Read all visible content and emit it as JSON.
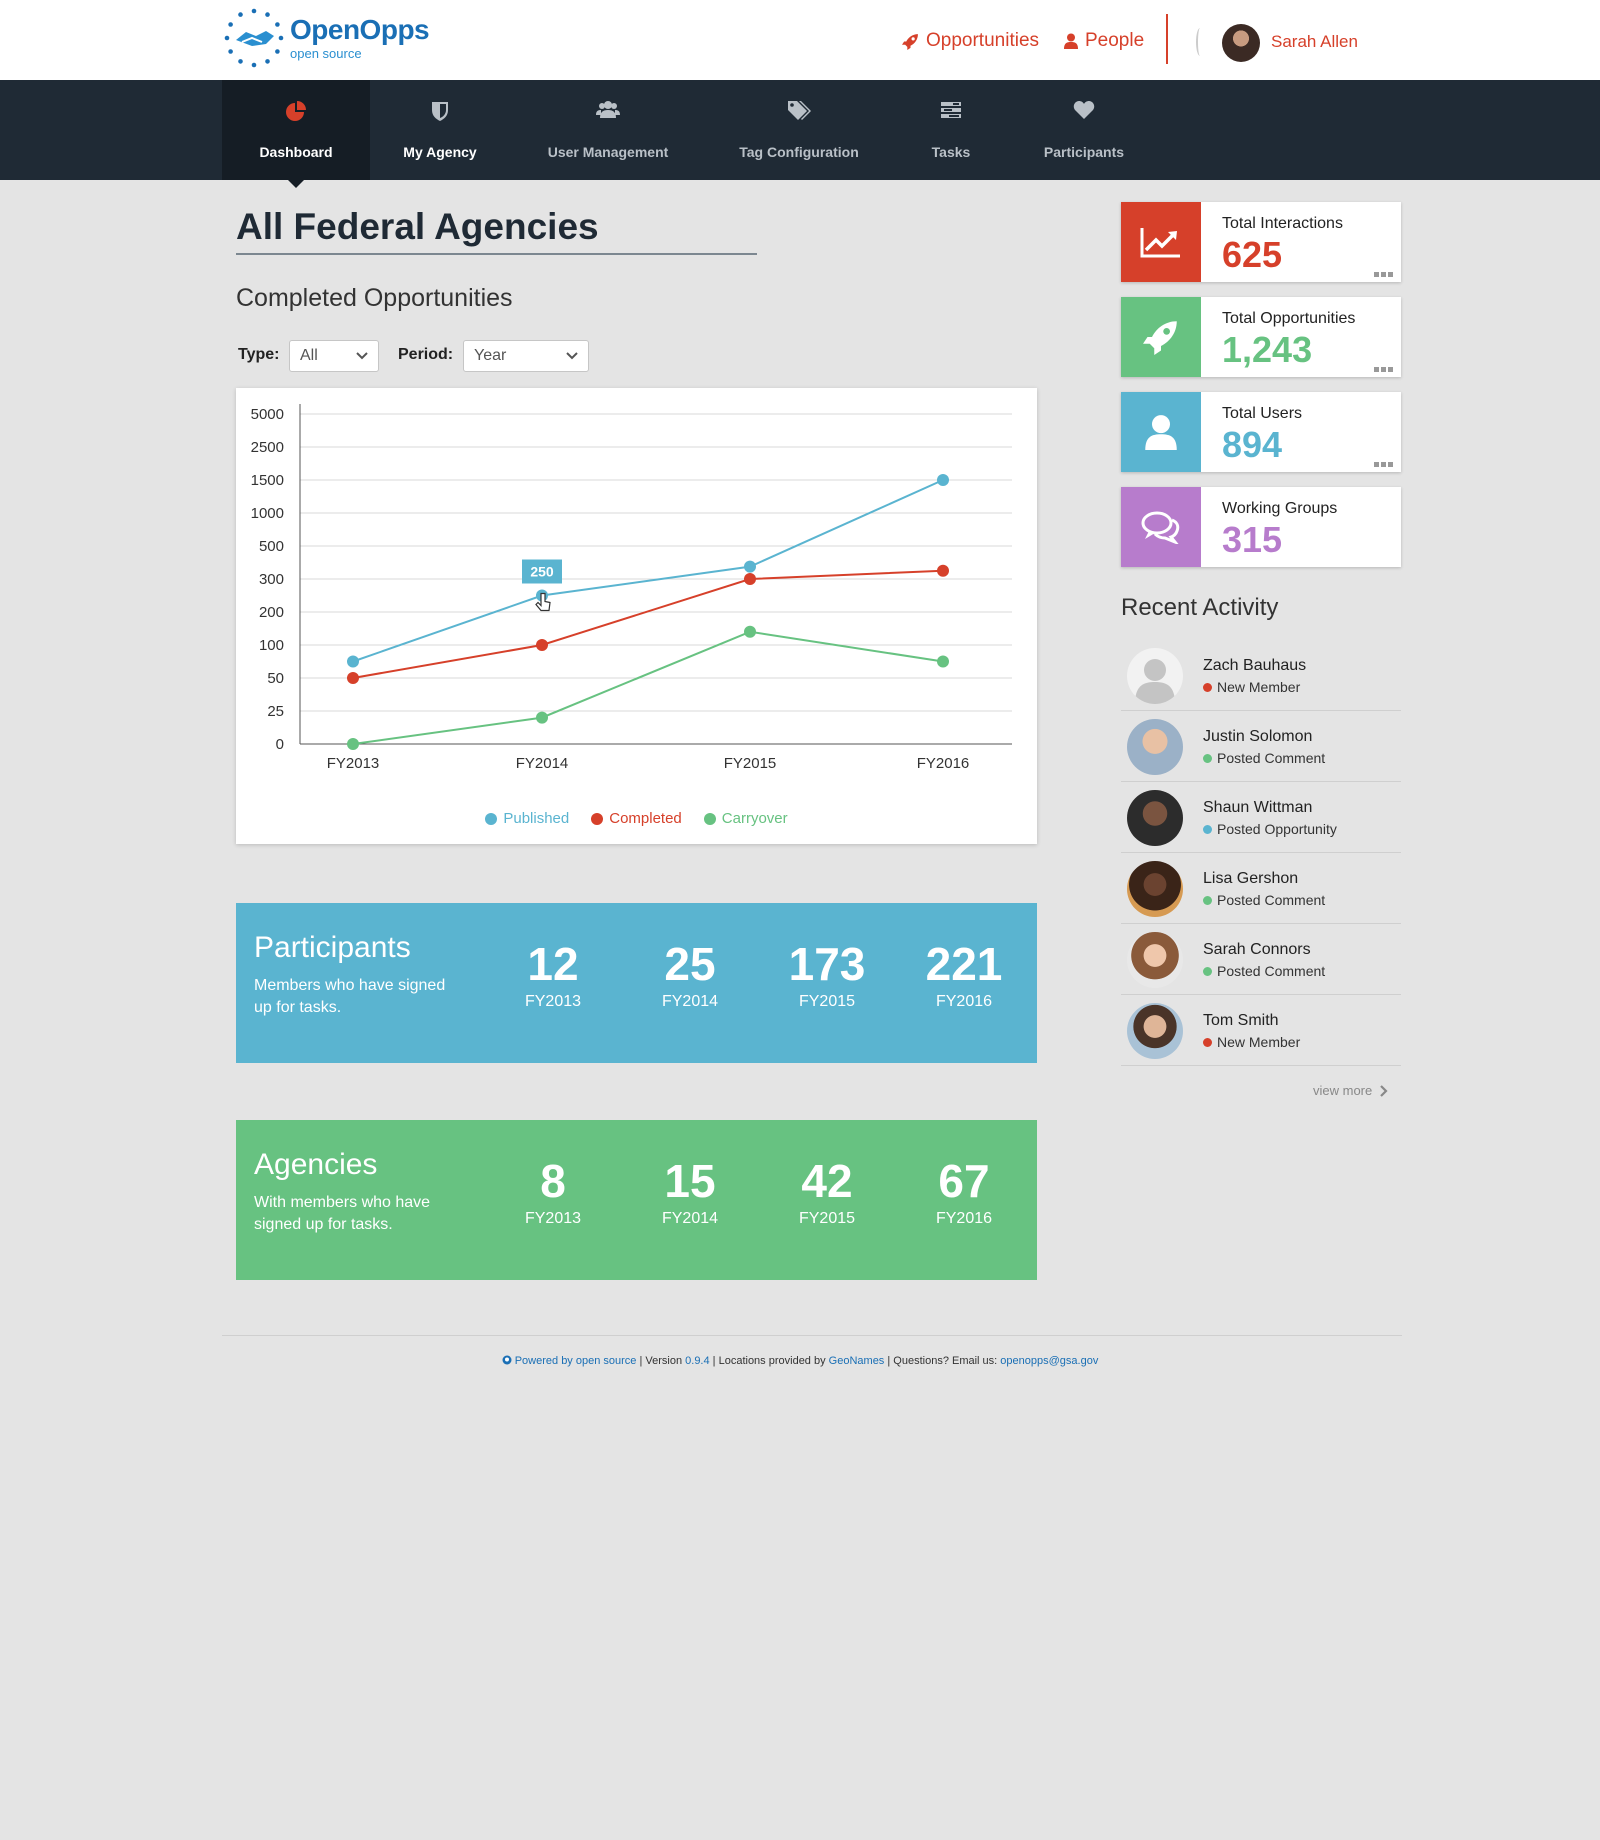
{
  "header": {
    "brand": "OpenOpps",
    "brand_sub": "open source",
    "links": {
      "opportunities": "Opportunities",
      "people": "People"
    },
    "user_name": "Sarah Allen"
  },
  "nav": {
    "items": [
      {
        "label": "Dashboard",
        "icon": "pie-chart-icon",
        "active": true
      },
      {
        "label": "My Agency",
        "icon": "shield-icon"
      },
      {
        "label": "User Management",
        "icon": "users-icon"
      },
      {
        "label": "Tag Configuration",
        "icon": "tags-icon"
      },
      {
        "label": "Tasks",
        "icon": "tasks-icon"
      },
      {
        "label": "Participants",
        "icon": "heart-icon"
      }
    ]
  },
  "page": {
    "title": "All Federal Agencies",
    "section_title": "Completed Opportunities",
    "filters": {
      "type_label": "Type:",
      "type_value": "All",
      "period_label": "Period:",
      "period_value": "Year"
    }
  },
  "chart_data": {
    "type": "line",
    "title": "",
    "xlabel": "",
    "ylabel": "",
    "categories": [
      "FY2013",
      "FY2014",
      "FY2015",
      "FY2016"
    ],
    "y_ticks": [
      0,
      25,
      50,
      100,
      200,
      300,
      500,
      1000,
      1500,
      2500,
      5000
    ],
    "grid": true,
    "legend_position": "bottom",
    "series": [
      {
        "name": "Published",
        "color": "#5ab4d0",
        "values": [
          75,
          250,
          375,
          1500
        ]
      },
      {
        "name": "Completed",
        "color": "#d6402a",
        "values": [
          50,
          100,
          300,
          350
        ]
      },
      {
        "name": "Carryover",
        "color": "#67c281",
        "values": [
          0,
          20,
          140,
          75
        ]
      }
    ],
    "tooltip": {
      "series": "Published",
      "category": "FY2014",
      "label": "250"
    }
  },
  "participants": {
    "title": "Participants",
    "desc": "Members who have signed up for tasks.",
    "stats": [
      {
        "value": "12",
        "year": "FY2013"
      },
      {
        "value": "25",
        "year": "FY2014"
      },
      {
        "value": "173",
        "year": "FY2015"
      },
      {
        "value": "221",
        "year": "FY2016"
      }
    ]
  },
  "agencies": {
    "title": "Agencies",
    "desc": "With members who have signed up for tasks.",
    "stats": [
      {
        "value": "8",
        "year": "FY2013"
      },
      {
        "value": "15",
        "year": "FY2014"
      },
      {
        "value": "42",
        "year": "FY2015"
      },
      {
        "value": "67",
        "year": "FY2016"
      }
    ]
  },
  "kpis": [
    {
      "label": "Total Interactions",
      "value": "625",
      "color": "#d6402a",
      "icon": "trend-icon"
    },
    {
      "label": "Total Opportunities",
      "value": "1,243",
      "color": "#67c281",
      "icon": "rocket-icon"
    },
    {
      "label": "Total Users",
      "value": "894",
      "color": "#5ab4d0",
      "icon": "user-icon"
    },
    {
      "label": "Working Groups",
      "value": "315",
      "color": "#b77ccc",
      "icon": "chat-icon"
    }
  ],
  "recent_activity": {
    "title": "Recent Activity",
    "items": [
      {
        "name": "Zach  Bauhaus",
        "action": "New Member",
        "status_color": "#d6402a"
      },
      {
        "name": "Justin Solomon",
        "action": "Posted Comment",
        "status_color": "#67c281"
      },
      {
        "name": "Shaun Wittman",
        "action": "Posted Opportunity",
        "status_color": "#5ab4d0"
      },
      {
        "name": "Lisa Gershon",
        "action": "Posted Comment",
        "status_color": "#67c281"
      },
      {
        "name": "Sarah Connors",
        "action": "Posted Comment",
        "status_color": "#67c281"
      },
      {
        "name": "Tom Smith",
        "action": "New Member",
        "status_color": "#d6402a"
      }
    ],
    "view_more": "view more"
  },
  "footer": {
    "powered": "Powered by open source",
    "version_prefix": "| Version",
    "version": "0.9.4",
    "locations_prefix": "| Locations provided by",
    "locations": "GeoNames",
    "questions_prefix": "| Questions? Email us:",
    "email": "openopps@gsa.gov"
  }
}
